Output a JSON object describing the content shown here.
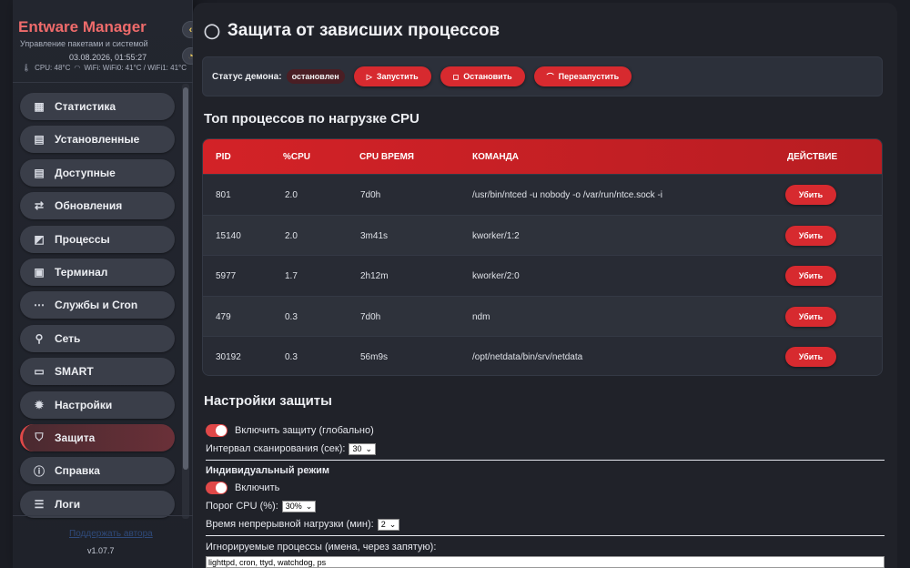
{
  "sidebar": {
    "brand": "Entware Manager",
    "subtitle": "Управление пакетами и системой",
    "datetime": "03.08.2026, 01:55:27",
    "cpu_temp": "CPU: 48°C",
    "wifi_temp": "WiFi: WiFi0: 41°C / WiFi1: 41°C",
    "items": [
      {
        "label": "Статистика",
        "icon": "table-icon"
      },
      {
        "label": "Установленные",
        "icon": "package-icon"
      },
      {
        "label": "Доступные",
        "icon": "box-icon"
      },
      {
        "label": "Обновления",
        "icon": "refresh-icon"
      },
      {
        "label": "Процессы",
        "icon": "chart-icon"
      },
      {
        "label": "Терминал",
        "icon": "terminal-icon"
      },
      {
        "label": "Службы и Cron",
        "icon": "dots-icon"
      },
      {
        "label": "Сеть",
        "icon": "network-icon"
      },
      {
        "label": "SMART",
        "icon": "disk-icon"
      },
      {
        "label": "Настройки",
        "icon": "gear-icon"
      },
      {
        "label": "Защита",
        "icon": "shield-icon"
      },
      {
        "label": "Справка",
        "icon": "info-icon"
      },
      {
        "label": "Логи",
        "icon": "document-icon"
      }
    ],
    "active_item": "Защита",
    "dev_link": "Поддержать автора",
    "version": "v1.07.7"
  },
  "page": {
    "title": "Защита от зависших процессов",
    "daemon_label": "Статус демона:",
    "daemon_status": "остановлен",
    "btn_start": "Запустить",
    "btn_stop": "Остановить",
    "btn_restart": "Перезапустить"
  },
  "top_processes": {
    "title": "Топ процессов по нагрузке CPU",
    "columns": [
      "PID",
      "%CPU",
      "CPU ВРЕМЯ",
      "КОМАНДА",
      "ДЕЙСТВИЕ"
    ],
    "kill_label": "Убить",
    "rows": [
      {
        "pid": "801",
        "cpu": "2.0",
        "time": "7d0h",
        "cmd": "/usr/bin/ntced -u nobody -o /var/run/ntce.sock -i"
      },
      {
        "pid": "15140",
        "cpu": "2.0",
        "time": "3m41s",
        "cmd": "kworker/1:2"
      },
      {
        "pid": "5977",
        "cpu": "1.7",
        "time": "2h12m",
        "cmd": "kworker/2:0"
      },
      {
        "pid": "479",
        "cpu": "0.3",
        "time": "7d0h",
        "cmd": "ndm"
      },
      {
        "pid": "30192",
        "cpu": "0.3",
        "time": "56m9s",
        "cmd": "/opt/netdata/bin/srv/netdata"
      }
    ]
  },
  "settings": {
    "title": "Настройки защиты",
    "global_toggle": "Включить защиту (глобально)",
    "scan_interval_label": "Интервал сканирования (сек):",
    "scan_interval_value": "30",
    "individual_mode": "Индивидуальный режим",
    "individual_toggle": "Включить",
    "cpu_threshold_label": "Порог CPU (%):",
    "cpu_threshold_value": "30%",
    "load_time_label": "Время непрерывной нагрузки (мин):",
    "load_time_value": "2",
    "ignored_label": "Игнорируемые процессы (имена, через запятую):",
    "ignored_value": "lighttpd, cron, ttyd, watchdog, ps"
  },
  "colors": {
    "accent": "#d72a2f",
    "brand": "#ef6b6b",
    "bg": "#202229"
  }
}
